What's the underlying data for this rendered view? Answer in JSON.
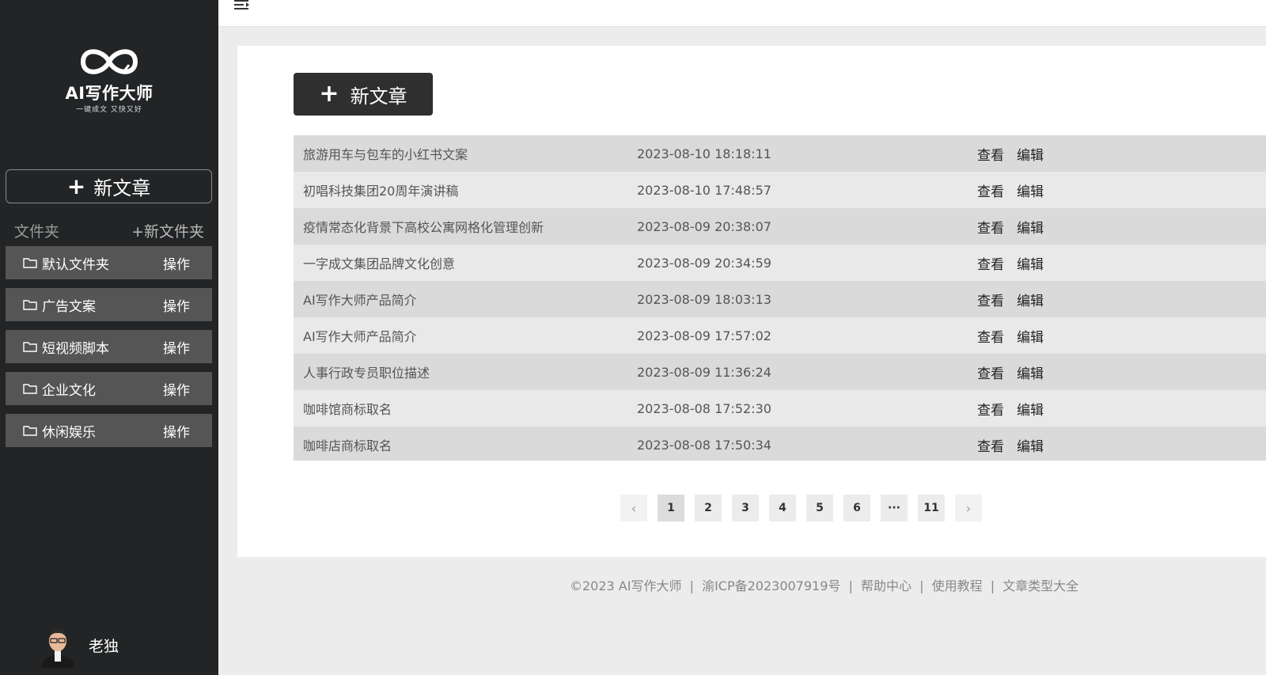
{
  "logo": {
    "title": "AI写作大师",
    "subtitle": "一键成文 又快又好"
  },
  "sidebar": {
    "new_article": "新文章",
    "folder_title": "文件夹",
    "add_folder": "+新文件夹",
    "folders": [
      {
        "name": "默认文件夹",
        "op": "操作"
      },
      {
        "name": "广告文案",
        "op": "操作"
      },
      {
        "name": "短视频脚本",
        "op": "操作"
      },
      {
        "name": "企业文化",
        "op": "操作"
      },
      {
        "name": "休闲娱乐",
        "op": "操作"
      }
    ],
    "user": {
      "name": "老独"
    }
  },
  "main": {
    "new_article": "新文章",
    "actions": {
      "view": "查看",
      "edit": "编辑"
    },
    "articles": [
      {
        "title": "旅游用车与包车的小红书文案",
        "time": "2023-08-10 18:18:11"
      },
      {
        "title": "初唱科技集团20周年演讲稿",
        "time": "2023-08-10 17:48:57"
      },
      {
        "title": "疫情常态化背景下高校公寓网格化管理创新",
        "time": "2023-08-09 20:38:07"
      },
      {
        "title": "一字成文集团品牌文化创意",
        "time": "2023-08-09 20:34:59"
      },
      {
        "title": "AI写作大师产品简介",
        "time": "2023-08-09 18:03:13"
      },
      {
        "title": "AI写作大师产品简介",
        "time": "2023-08-09 17:57:02"
      },
      {
        "title": "人事行政专员职位描述",
        "time": "2023-08-09 11:36:24"
      },
      {
        "title": "咖啡馆商标取名",
        "time": "2023-08-08 17:52:30"
      },
      {
        "title": "咖啡店商标取名",
        "time": "2023-08-08 17:50:34"
      }
    ],
    "pagination": {
      "prev": "‹",
      "pages": [
        "1",
        "2",
        "3",
        "4",
        "5",
        "6",
        "···",
        "11"
      ],
      "next": "›",
      "current": "1"
    }
  },
  "footer": {
    "copyright": "©2023 AI写作大师",
    "icp": "渝ICP备2023007919号",
    "links": [
      "帮助中心",
      "使用教程",
      "文章类型大全"
    ],
    "separator": "|"
  },
  "colors": {
    "sidebar_bg": "#222426",
    "folder_bg": "#555555",
    "button_dark": "#2f2f2f",
    "row_odd": "#dadada",
    "row_even": "#e9e9e9"
  }
}
